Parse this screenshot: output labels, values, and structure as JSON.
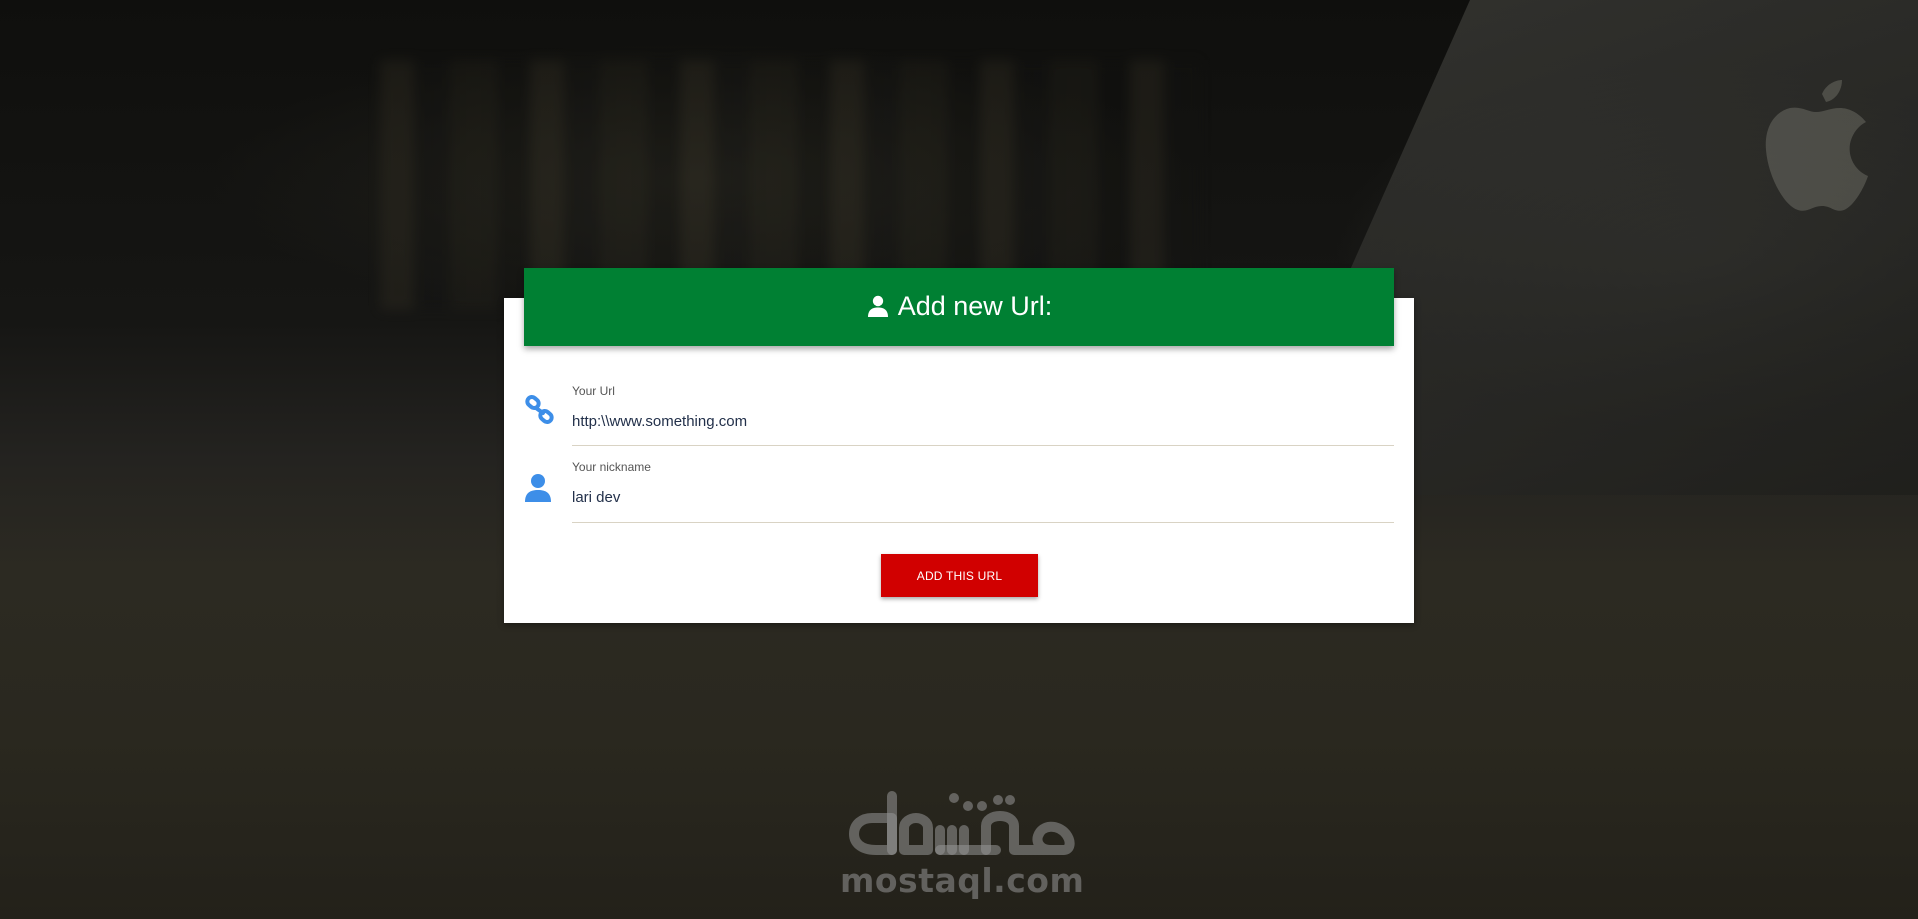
{
  "form": {
    "title": "Add new Url:",
    "url_field": {
      "label": "Your Url",
      "value": "http:\\\\www.something.com",
      "icon": "link-icon"
    },
    "nickname_field": {
      "label": "Your nickname",
      "value": "lari dev",
      "icon": "user-icon"
    },
    "submit_label": "ADD THIS URL"
  },
  "watermark": {
    "arabic_text": "مستقل",
    "text": "mostaql.com"
  },
  "colors": {
    "header_green": "#008033",
    "button_red": "#d10000",
    "icon_blue": "#3d8ee8",
    "card_bg": "#ffffff"
  }
}
